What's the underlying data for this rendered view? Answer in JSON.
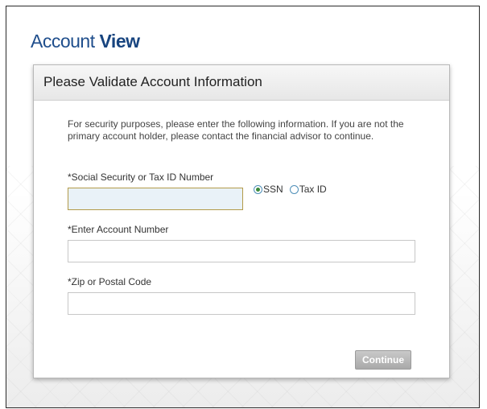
{
  "brand": {
    "prefix": "Account ",
    "strong": "View"
  },
  "panel": {
    "title": "Please Validate Account Information",
    "intro": "For security purposes, please enter the following information. If you are not the primary account holder, please contact the financial advisor to continue."
  },
  "form": {
    "ssn_label": "*Social Security or Tax ID Number",
    "ssn_value": "",
    "id_type_options": [
      {
        "label": "SSN",
        "selected": true
      },
      {
        "label": "Tax ID",
        "selected": false
      }
    ],
    "account_label": "*Enter Account Number",
    "account_value": "",
    "zip_label": "*Zip or Postal Code",
    "zip_value": "",
    "continue_label": "Continue"
  },
  "colors": {
    "brand": "#1f4e8c",
    "ssn_field_bg": "#e9f2f8",
    "ssn_field_border": "#b39b4a",
    "button_disabled": "#b5b5b5"
  }
}
